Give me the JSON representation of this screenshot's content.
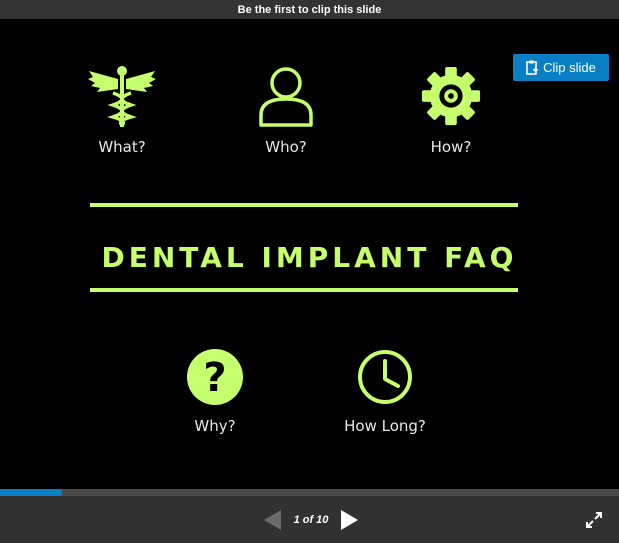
{
  "banner": {
    "text": "Be the first to clip this slide"
  },
  "clip_button": {
    "label": "Clip slide"
  },
  "slide": {
    "title": "DENTAL IMPLANT FAQ",
    "accent_color": "#c6ff6e",
    "items": [
      {
        "label": "What?",
        "icon": "caduceus-icon"
      },
      {
        "label": "Who?",
        "icon": "person-icon"
      },
      {
        "label": "How?",
        "icon": "gear-icon"
      },
      {
        "label": "Why?",
        "icon": "question-icon"
      },
      {
        "label": "How Long?",
        "icon": "clock-icon"
      }
    ]
  },
  "player": {
    "page_indicator": "1 of 10",
    "progress_fraction": 0.1,
    "progress_color": "#0b7fc4"
  }
}
